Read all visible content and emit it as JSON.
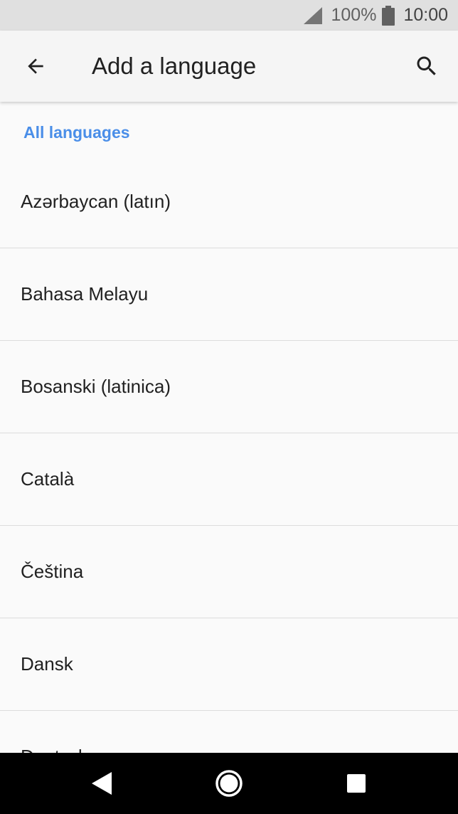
{
  "status_bar": {
    "battery_percent": "100%",
    "time": "10:00",
    "icons": [
      "signal-icon",
      "battery-icon"
    ]
  },
  "app_bar": {
    "title": "Add a language",
    "back_icon": "arrow-left-icon",
    "search_icon": "search-icon"
  },
  "content": {
    "section_header": "All languages",
    "languages": [
      "Azərbaycan (latın)",
      "Bahasa Melayu",
      "Bosanski (latinica)",
      "Català",
      "Čeština",
      "Dansk",
      "Deutsch"
    ]
  },
  "nav_bar": {
    "icons": [
      "triangle-back-icon",
      "circle-home-icon",
      "square-recents-icon"
    ]
  },
  "colors": {
    "accent": "#4a8ee8",
    "status_bar_bg": "#e0e0e0",
    "app_bar_bg": "#f5f5f5",
    "background": "#fafafa",
    "nav_bar_bg": "#000000",
    "text_primary": "#212121",
    "divider": "#dcdcdc"
  }
}
